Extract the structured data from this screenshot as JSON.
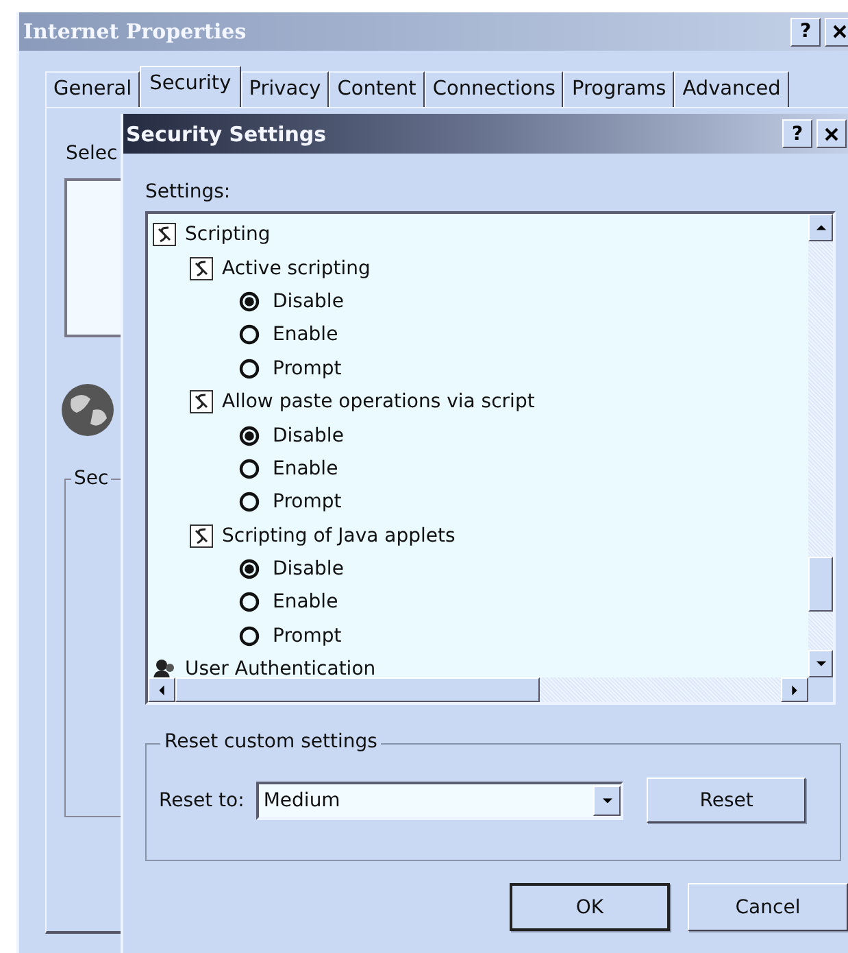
{
  "background_window": {
    "title": "Internet Properties",
    "help": "?",
    "tabs": [
      {
        "label": "General",
        "selected": false
      },
      {
        "label": "Security",
        "selected": true
      },
      {
        "label": "Privacy",
        "selected": false
      },
      {
        "label": "Content",
        "selected": false
      },
      {
        "label": "Connections",
        "selected": false
      },
      {
        "label": "Programs",
        "selected": false
      },
      {
        "label": "Advanced",
        "selected": false
      }
    ],
    "zone_prompt": "Selec",
    "group_label": "Sec"
  },
  "dialog": {
    "title": "Security Settings",
    "help": "?",
    "settings_label": "Settings:",
    "tree": [
      {
        "label": "Scripting",
        "kind": "script",
        "children": [
          {
            "label": "Active scripting",
            "kind": "script",
            "options": [
              {
                "label": "Disable",
                "selected": true
              },
              {
                "label": "Enable",
                "selected": false
              },
              {
                "label": "Prompt",
                "selected": false
              }
            ]
          },
          {
            "label": "Allow paste operations via script",
            "kind": "script",
            "options": [
              {
                "label": "Disable",
                "selected": true
              },
              {
                "label": "Enable",
                "selected": false
              },
              {
                "label": "Prompt",
                "selected": false
              }
            ]
          },
          {
            "label": "Scripting of Java applets",
            "kind": "script",
            "options": [
              {
                "label": "Disable",
                "selected": true
              },
              {
                "label": "Enable",
                "selected": false
              },
              {
                "label": "Prompt",
                "selected": false
              }
            ]
          }
        ]
      },
      {
        "label": "User Authentication",
        "kind": "user"
      }
    ],
    "reset_group": {
      "legend": "Reset custom settings",
      "label": "Reset to:",
      "value": "Medium",
      "button": "Reset"
    },
    "buttons": [
      "OK",
      "Cancel"
    ]
  }
}
